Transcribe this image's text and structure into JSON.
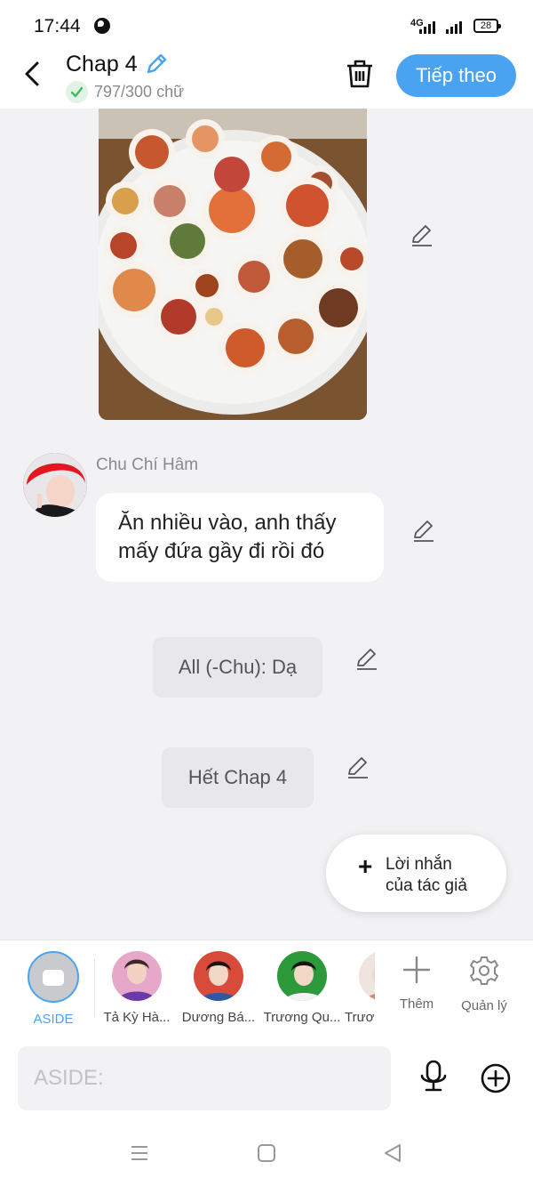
{
  "status_bar": {
    "time": "17:44",
    "network": "4G",
    "battery": "28"
  },
  "header": {
    "title": "Chap 4",
    "word_count": "797/300 chữ",
    "next_label": "Tiếp theo"
  },
  "messages": [
    {
      "type": "image",
      "alt": "food-table-photo"
    },
    {
      "type": "character",
      "sender": "Chu Chí Hâm",
      "lines": [
        "Ăn nhiều vào, anh thấy",
        "mấy đứa gầy đi rồi đó"
      ]
    },
    {
      "type": "aside",
      "text": "All (-Chu): Dạ"
    },
    {
      "type": "aside",
      "text": "Hết Chap 4"
    }
  ],
  "author_note": {
    "line1": "Lời nhắn",
    "line2": "của tác giả"
  },
  "characters": {
    "aside_label": "ASIDE",
    "items": [
      {
        "name": "Tả Kỳ Hà..."
      },
      {
        "name": "Dương Bá..."
      },
      {
        "name": "Trương Qu..."
      },
      {
        "name": "Trươ"
      }
    ],
    "add_label": "Thêm",
    "manage_label": "Quản lý"
  },
  "composer": {
    "placeholder": "ASIDE:"
  },
  "colors": {
    "accent": "#4aa3f0",
    "background": "#f2f2f4",
    "bubble": "#ffffff",
    "aside_bubble": "#e8e8ea"
  }
}
